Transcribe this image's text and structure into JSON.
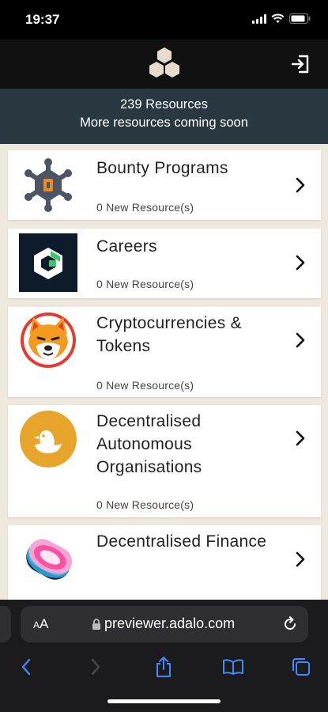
{
  "status_bar": {
    "time": "19:37"
  },
  "banner": {
    "count_line": "239 Resources",
    "sub_line": "More resources coming soon"
  },
  "categories": [
    {
      "title": "Bounty Programs",
      "subtitle": "0 New Resource(s)",
      "icon": "sheriff-badge-icon"
    },
    {
      "title": "Careers",
      "subtitle": "0 New Resource(s)",
      "icon": "careers-logo-icon"
    },
    {
      "title": "Cryptocurrencies & Tokens",
      "subtitle": "0 New Resource(s)",
      "icon": "shiba-inu-icon"
    },
    {
      "title": "Decentralised Autonomous Organisations",
      "subtitle": "0 New Resource(s)",
      "icon": "duck-icon"
    },
    {
      "title": "Decentralised Finance",
      "subtitle": "",
      "icon": "sushi-icon"
    }
  ],
  "browser": {
    "aa_label": "AA",
    "url": "previewer.adalo.com"
  },
  "colors": {
    "banner_bg": "#2a3842",
    "list_bg": "#efe8dd",
    "link_blue": "#3d8bfd"
  }
}
